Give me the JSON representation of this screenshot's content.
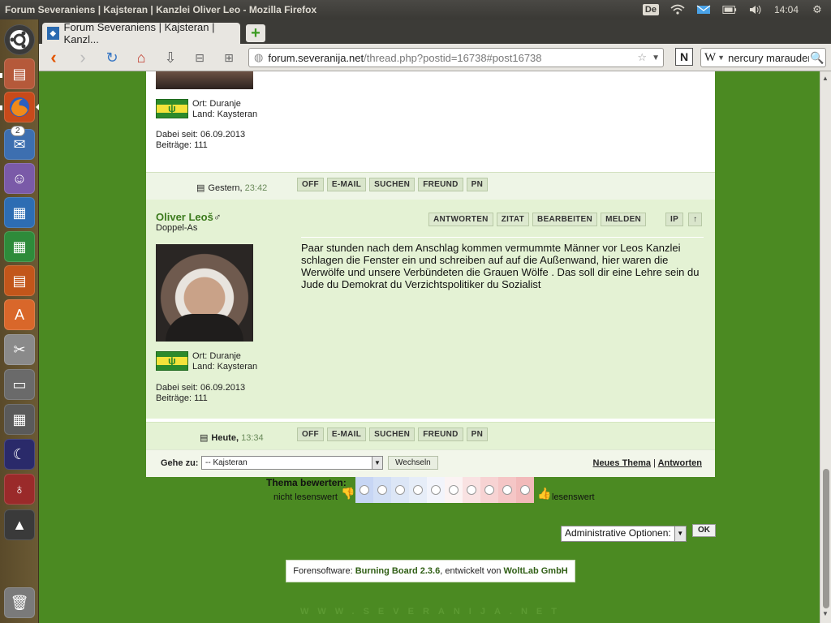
{
  "system": {
    "window_title": "Forum Severaniens | Kajsteran | Kanzlei Oliver Leo - Mozilla Firefox",
    "keyboard_layout": "De",
    "clock": "14:04"
  },
  "launcher": {
    "notification_badge": "2"
  },
  "browser": {
    "tab_title": "Forum Severaniens | Kajsteran | Kanzl...",
    "url_host": "forum.severanija.net",
    "url_path": "/thread.php?postid=16738#post16738",
    "search_engine_label": "W",
    "search_text": "nercury marauder"
  },
  "post_above": {
    "location": "Ort: Duranje",
    "country": "Land: Kaysteran",
    "joined": "Dabei seit: 06.09.2013",
    "posts": "Beiträge: 111",
    "date_label": "Gestern,",
    "date_time": "23:42",
    "buttons": [
      "OFF",
      "E-MAIL",
      "SUCHEN",
      "FREUND",
      "PN"
    ]
  },
  "post": {
    "author": "Oliver Leoš",
    "gender_symbol": "♂",
    "rank": "Doppel-As",
    "top_buttons": [
      "ANTWORTEN",
      "ZITAT",
      "BEARBEITEN",
      "MELDEN"
    ],
    "ip_button": "IP",
    "up_button": "↑",
    "message": "Paar stunden nach dem Anschlag kommen vermummte Männer vor Leos Kanzlei schlagen die Fenster ein und schreiben auf auf die Außenwand, hier waren die Werwölfe und unsere Verbündeten die Grauen Wölfe . Das soll dir eine Lehre sein du Jude du Demokrat du Verzichtspolitiker du Sozialist",
    "location": "Ort: Duranje",
    "country": "Land: Kaysteran",
    "joined": "Dabei seit: 06.09.2013",
    "posts": "Beiträge: 111",
    "date_label": "Heute,",
    "date_time": "13:34",
    "buttons": [
      "OFF",
      "E-MAIL",
      "SUCHEN",
      "FREUND",
      "PN"
    ]
  },
  "goto": {
    "label": "Gehe zu:",
    "selected": "-- Kajsteran",
    "button": "Wechseln",
    "new_thread": "Neues Thema",
    "separator": "|",
    "reply": "Antworten"
  },
  "rating": {
    "title": "Thema bewerten:",
    "low_label": "nicht lesenswert",
    "high_label": "lesenswert",
    "scale_colors": [
      "#c7d6f4",
      "#d2dff5",
      "#dce6f6",
      "#e6edf8",
      "#f2f4fb",
      "#fbf3f3",
      "#f9e2e2",
      "#f7d3d3",
      "#f5c6c6",
      "#f2baba"
    ]
  },
  "admin": {
    "select_label": "Administrative Optionen:",
    "ok_button": "OK"
  },
  "footer": {
    "prefix": "Forensoftware:",
    "software": "Burning Board 2.3.6",
    "middle": ", entwickelt von",
    "company": "WoltLab GmbH",
    "watermark": "WWW.SEVERANIJA.NET"
  },
  "colors": {
    "page_background": "#4b8a22",
    "post_background": "#e4f2d4",
    "author_color": "#3b7a1c"
  }
}
